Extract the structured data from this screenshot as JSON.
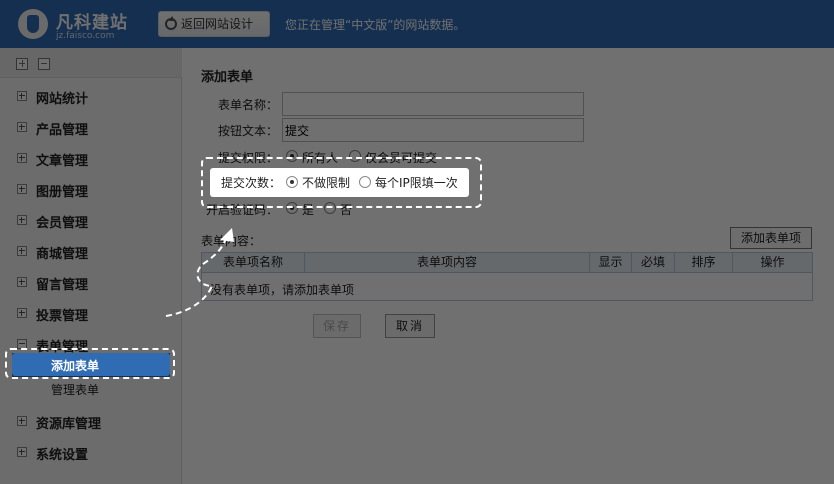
{
  "header": {
    "logo_text": "凡科建站",
    "logo_sub": "jz.faisco.com",
    "back_button": "返回网站设计",
    "notice": "您正在管理“中文版”的网站数据。"
  },
  "sidebar": {
    "items": [
      {
        "label": "网站统计"
      },
      {
        "label": "产品管理"
      },
      {
        "label": "文章管理"
      },
      {
        "label": "图册管理"
      },
      {
        "label": "会员管理"
      },
      {
        "label": "商城管理"
      },
      {
        "label": "留言管理"
      },
      {
        "label": "投票管理"
      },
      {
        "label": "表单管理"
      },
      {
        "label": "资源库管理"
      },
      {
        "label": "系统设置"
      }
    ],
    "sub_items": [
      {
        "label": "添加表单"
      },
      {
        "label": "管理表单"
      }
    ]
  },
  "main": {
    "title": "添加表单",
    "form_name_label": "表单名称：",
    "form_name_value": "",
    "button_text_label": "按钮文本：",
    "button_text_value": "提交",
    "permission_label": "提交权限：",
    "permission_options": [
      "所有人",
      "仅会员可提交"
    ],
    "submit_count_label": "提交次数：",
    "submit_count_options": [
      "不做限制",
      "每个IP限填一次"
    ],
    "captcha_label": "开启验证码：",
    "captcha_options": [
      "是",
      "否"
    ],
    "content_label": "表单内容：",
    "add_item_button": "添加表单项",
    "table": {
      "headers": [
        "表单项名称",
        "表单项内容",
        "显示",
        "必填",
        "排序",
        "操作"
      ],
      "empty_message": "没有表单项，请添加表单项"
    },
    "save_button": "保存",
    "cancel_button": "取消"
  },
  "colors": {
    "header_bg": "#2f6cb4",
    "active_item_bg": "#2f6cb4",
    "overlay": "rgba(0,0,0,0.56)"
  }
}
